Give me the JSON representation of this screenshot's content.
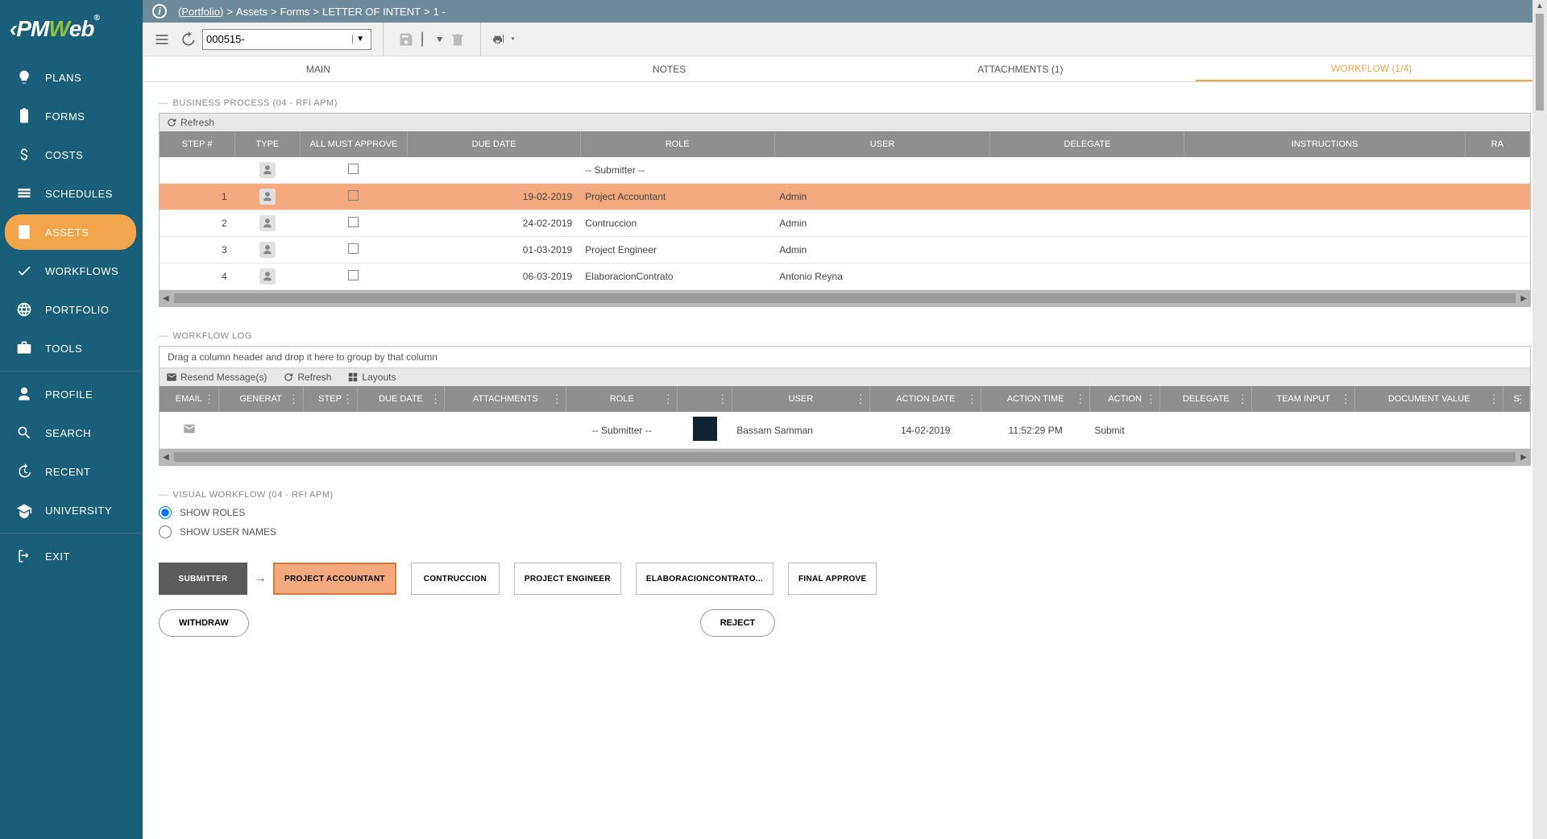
{
  "logo_text": "PMWeb",
  "breadcrumb": [
    "(Portfolio)",
    "Assets",
    "Forms",
    "LETTER OF INTENT",
    "1 -"
  ],
  "record_id": "000515-",
  "nav": [
    {
      "label": "PLANS",
      "icon": "bulb"
    },
    {
      "label": "FORMS",
      "icon": "clipboard"
    },
    {
      "label": "COSTS",
      "icon": "dollar"
    },
    {
      "label": "SCHEDULES",
      "icon": "bars"
    },
    {
      "label": "ASSETS",
      "icon": "building",
      "active": true
    },
    {
      "label": "WORKFLOWS",
      "icon": "check"
    },
    {
      "label": "PORTFOLIO",
      "icon": "globe"
    },
    {
      "label": "TOOLS",
      "icon": "briefcase"
    },
    {
      "__div": true
    },
    {
      "label": "PROFILE",
      "icon": "person"
    },
    {
      "label": "SEARCH",
      "icon": "search"
    },
    {
      "label": "RECENT",
      "icon": "history"
    },
    {
      "label": "UNIVERSITY",
      "icon": "grad"
    },
    {
      "__div": true
    },
    {
      "label": "EXIT",
      "icon": "exit"
    }
  ],
  "tabs": [
    {
      "label": "MAIN"
    },
    {
      "label": "NOTES"
    },
    {
      "label": "ATTACHMENTS (1)"
    },
    {
      "label": "WORKFLOW (1/4)",
      "active": true
    }
  ],
  "bp": {
    "title": "BUSINESS PROCESS (04 - RFI APM)",
    "refresh": "Refresh",
    "headers": [
      "STEP #",
      "TYPE",
      "ALL MUST APPROVE",
      "DUE DATE",
      "ROLE",
      "USER",
      "DELEGATE",
      "INSTRUCTIONS",
      "RA"
    ],
    "rows": [
      {
        "step": "",
        "due": "",
        "role": "-- Submitter --",
        "user": ""
      },
      {
        "step": "1",
        "due": "19-02-2019",
        "role": "Project Accountant",
        "user": "Admin",
        "hl": true
      },
      {
        "step": "2",
        "due": "24-02-2019",
        "role": "Contruccion",
        "user": "Admin"
      },
      {
        "step": "3",
        "due": "01-03-2019",
        "role": "Project Engineer",
        "user": "Admin"
      },
      {
        "step": "4",
        "due": "06-03-2019",
        "role": "ElaboracionContrato",
        "user": "Antonio Reyna"
      }
    ]
  },
  "log": {
    "title": "WORKFLOW LOG",
    "group_hint": "Drag a column header and drop it here to group by that column",
    "resend": "Resend Message(s)",
    "refresh": "Refresh",
    "layouts": "Layouts",
    "headers": [
      "EMAIL",
      "GENERAT",
      "STEP",
      "DUE DATE",
      "ATTACHMENTS",
      "ROLE",
      "",
      "USER",
      "ACTION DATE",
      "ACTION TIME",
      "ACTION",
      "DELEGATE",
      "TEAM INPUT",
      "DOCUMENT VALUE",
      "S"
    ],
    "row": {
      "role": "-- Submitter --",
      "user": "Bassam Samman",
      "date": "14-02-2019",
      "time": "11:52:29 PM",
      "action": "Submit"
    }
  },
  "vw": {
    "title": "VISUAL WORKFLOW (04 - RFI APM)",
    "opt1": "SHOW ROLES",
    "opt2": "SHOW USER NAMES",
    "boxes": [
      "SUBMITTER",
      "PROJECT ACCOUNTANT",
      "CONTRUCCION",
      "PROJECT ENGINEER",
      "ELABORACIONCONTRATO...",
      "FINAL APPROVE"
    ],
    "withdraw": "WITHDRAW",
    "reject": "REJECT"
  }
}
